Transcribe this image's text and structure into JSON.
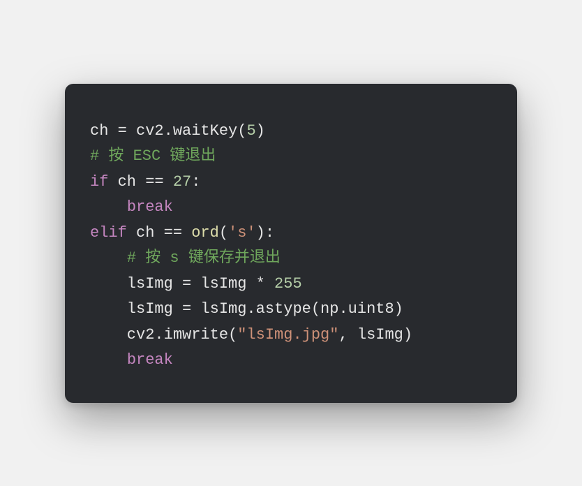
{
  "code": {
    "tokens": [
      {
        "cls": "tok-default",
        "text": "ch = cv2.waitKey("
      },
      {
        "cls": "tok-number",
        "text": "5"
      },
      {
        "cls": "tok-default",
        "text": ")\n"
      },
      {
        "cls": "tok-comment",
        "text": "# 按 ESC 键退出"
      },
      {
        "cls": "tok-default",
        "text": "\n"
      },
      {
        "cls": "tok-keyword",
        "text": "if"
      },
      {
        "cls": "tok-default",
        "text": " ch == "
      },
      {
        "cls": "tok-number",
        "text": "27"
      },
      {
        "cls": "tok-default",
        "text": ":\n    "
      },
      {
        "cls": "tok-keyword",
        "text": "break"
      },
      {
        "cls": "tok-default",
        "text": "\n"
      },
      {
        "cls": "tok-keyword",
        "text": "elif"
      },
      {
        "cls": "tok-default",
        "text": " ch == "
      },
      {
        "cls": "tok-builtin",
        "text": "ord"
      },
      {
        "cls": "tok-default",
        "text": "("
      },
      {
        "cls": "tok-string",
        "text": "'s'"
      },
      {
        "cls": "tok-default",
        "text": "):\n    "
      },
      {
        "cls": "tok-comment",
        "text": "# 按 s 键保存并退出"
      },
      {
        "cls": "tok-default",
        "text": "\n    lsImg = lsImg * "
      },
      {
        "cls": "tok-number",
        "text": "255"
      },
      {
        "cls": "tok-default",
        "text": "\n    lsImg = lsImg.astype(np.uint8)\n    cv2.imwrite("
      },
      {
        "cls": "tok-string",
        "text": "\"lsImg.jpg\""
      },
      {
        "cls": "tok-default",
        "text": ", lsImg)\n    "
      },
      {
        "cls": "tok-keyword",
        "text": "break"
      }
    ]
  }
}
